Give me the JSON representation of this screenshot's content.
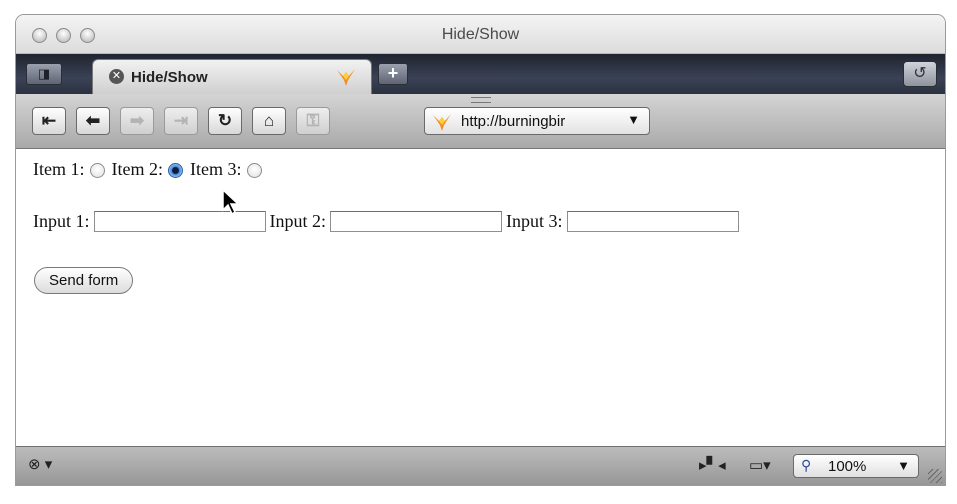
{
  "window": {
    "title": "Hide/Show"
  },
  "tab": {
    "label": "Hide/Show"
  },
  "toolbar": {
    "buttons": [
      {
        "name": "first-page",
        "icon": "first-page-icon",
        "glyph": "⇤",
        "enabled": true
      },
      {
        "name": "back",
        "icon": "arrow-left-icon",
        "glyph": "⬅",
        "enabled": true
      },
      {
        "name": "forward",
        "icon": "arrow-right-icon",
        "glyph": "➡",
        "enabled": false
      },
      {
        "name": "last-page",
        "icon": "last-page-icon",
        "glyph": "⇥",
        "enabled": false
      },
      {
        "name": "reload",
        "icon": "reload-icon",
        "glyph": "↻",
        "enabled": true
      },
      {
        "name": "home",
        "icon": "home-icon",
        "glyph": "⌂",
        "enabled": true
      },
      {
        "name": "security",
        "icon": "key-icon",
        "glyph": "⚿",
        "enabled": false
      }
    ],
    "url": "http://burningbir"
  },
  "form": {
    "radios": [
      {
        "label": "Item 1:",
        "checked": false
      },
      {
        "label": "Item 2:",
        "checked": true
      },
      {
        "label": "Item 3:",
        "checked": false
      }
    ],
    "inputs": [
      {
        "label": "Input 1:",
        "value": ""
      },
      {
        "label": "Input 2:",
        "value": ""
      },
      {
        "label": "Input 3:",
        "value": ""
      }
    ],
    "submit_label": "Send form"
  },
  "statusbar": {
    "zoom": "100%"
  },
  "colors": {
    "radio_checked": "#4d8fe0",
    "tabstrip": "#2b3140",
    "logo_orange": "#f28c1e"
  }
}
